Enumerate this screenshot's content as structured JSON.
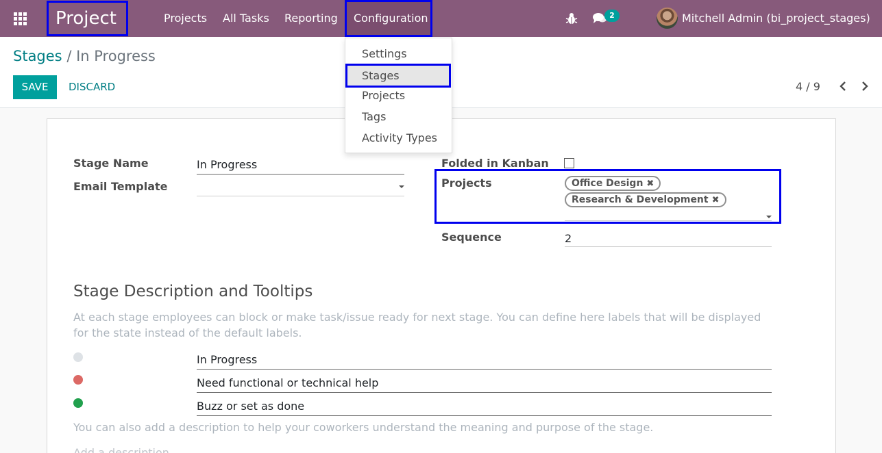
{
  "navbar": {
    "brand": "Project",
    "menu": [
      "Projects",
      "All Tasks",
      "Reporting",
      "Configuration"
    ],
    "message_count": "2",
    "user": "Mitchell Admin (bi_project_stages)"
  },
  "config_menu": [
    "Settings",
    "Stages",
    "Projects",
    "Tags",
    "Activity Types"
  ],
  "breadcrumb": {
    "parent": "Stages",
    "separator": "/",
    "current": "In Progress"
  },
  "buttons": {
    "save": "SAVE",
    "discard": "DISCARD"
  },
  "pager": {
    "value": "4 / 9"
  },
  "form": {
    "stage_name_label": "Stage Name",
    "stage_name_value": "In Progress",
    "email_template_label": "Email Template",
    "email_template_value": "",
    "folded_label": "Folded in Kanban",
    "folded_checked": false,
    "projects_label": "Projects",
    "projects_tags": [
      "Office Design",
      "Research & Development"
    ],
    "sequence_label": "Sequence",
    "sequence_value": "2"
  },
  "tooltips": {
    "title": "Stage Description and Tooltips",
    "help": "At each stage employees can block or make task/issue ready for next stage. You can define here labels that will be displayed for the state instead of the default labels.",
    "states": [
      {
        "color": "#dee2e6",
        "label": "In Progress"
      },
      {
        "color": "#dc6965",
        "label": "Need functional or technical help"
      },
      {
        "color": "#21a04d",
        "label": "Buzz or set as done"
      }
    ],
    "help2": "You can also add a description to help your coworkers understand the meaning and purpose of the stage.",
    "description_placeholder": "Add a description..."
  },
  "icons": {
    "apps": "apps-grid-icon",
    "bug": "bug-icon",
    "chat": "chat-icon",
    "prev": "chevron-left-icon",
    "next": "chevron-right-icon",
    "remove": "remove-x-icon"
  }
}
